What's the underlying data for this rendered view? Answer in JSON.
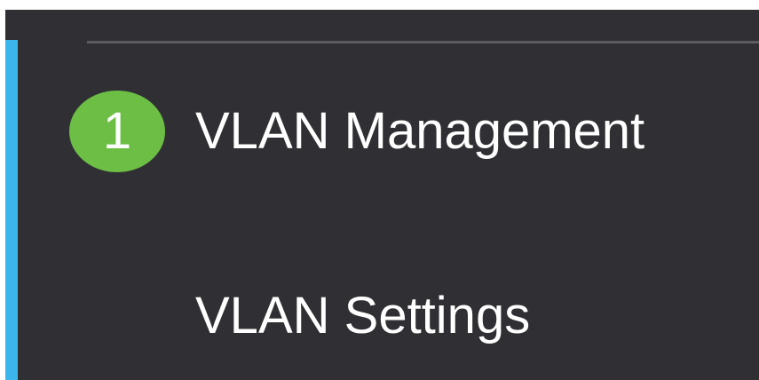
{
  "sidebar": {
    "items": [
      {
        "step_number": "1",
        "label": "VLAN Management"
      },
      {
        "label": "VLAN Settings"
      }
    ]
  },
  "colors": {
    "sidebar_background": "#303034",
    "accent": "#3cb6ea",
    "step_badge": "#6cbf44",
    "text": "#ffffff",
    "divider": "#5b5b61"
  }
}
